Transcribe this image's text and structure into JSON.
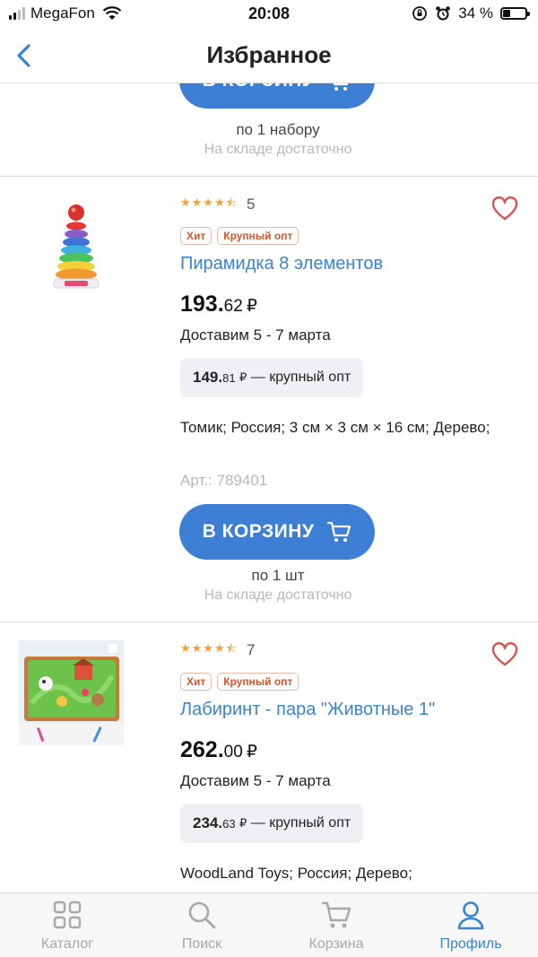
{
  "status_bar": {
    "carrier": "MegaFon",
    "time": "20:08",
    "battery": "34 %",
    "battery_fraction": 0.34
  },
  "nav": {
    "title": "Избранное"
  },
  "colors": {
    "accent": "#3d7fd5",
    "link": "#3a83d0",
    "star": "#f3a23a",
    "badge": "#d4542b",
    "heart": "#d9534f"
  },
  "top_item": {
    "cart_label": "В КОРЗИНУ",
    "per_unit": "по 1 набору",
    "stock": "На складе достаточно"
  },
  "products": [
    {
      "rating_count": "5",
      "badges": [
        "Хит",
        "Крупный опт"
      ],
      "title": "Пирамидка 8 элементов",
      "price_main": "193.",
      "price_cents": "62",
      "currency": "₽",
      "delivery": "Доставим 5 - 7 марта",
      "wholesale_main": "149.",
      "wholesale_cents": "81",
      "wholesale_currency": "₽",
      "wholesale_label": "— крупный опт",
      "description": "Томик; Россия; 3 см × 3 см × 16 см; Дерево;",
      "article": "Арт.: 789401",
      "cart_label": "В КОРЗИНУ",
      "per_unit": "по 1 шт",
      "stock": "На складе достаточно"
    },
    {
      "rating_count": "7",
      "badges": [
        "Хит",
        "Крупный опт"
      ],
      "title": "Лабиринт - пара \"Животные 1\"",
      "price_main": "262.",
      "price_cents": "00",
      "currency": "₽",
      "delivery": "Доставим 5 - 7 марта",
      "wholesale_main": "234.",
      "wholesale_cents": "63",
      "wholesale_currency": "₽",
      "wholesale_label": "— крупный опт",
      "description": "WoodLand Toys; Россия; Дерево;"
    }
  ],
  "tabbar": [
    {
      "label": "Каталог",
      "icon": "grid-icon",
      "active": false
    },
    {
      "label": "Поиск",
      "icon": "search-icon",
      "active": false
    },
    {
      "label": "Корзина",
      "icon": "cart-icon",
      "active": false
    },
    {
      "label": "Профиль",
      "icon": "profile-icon",
      "active": true
    }
  ]
}
